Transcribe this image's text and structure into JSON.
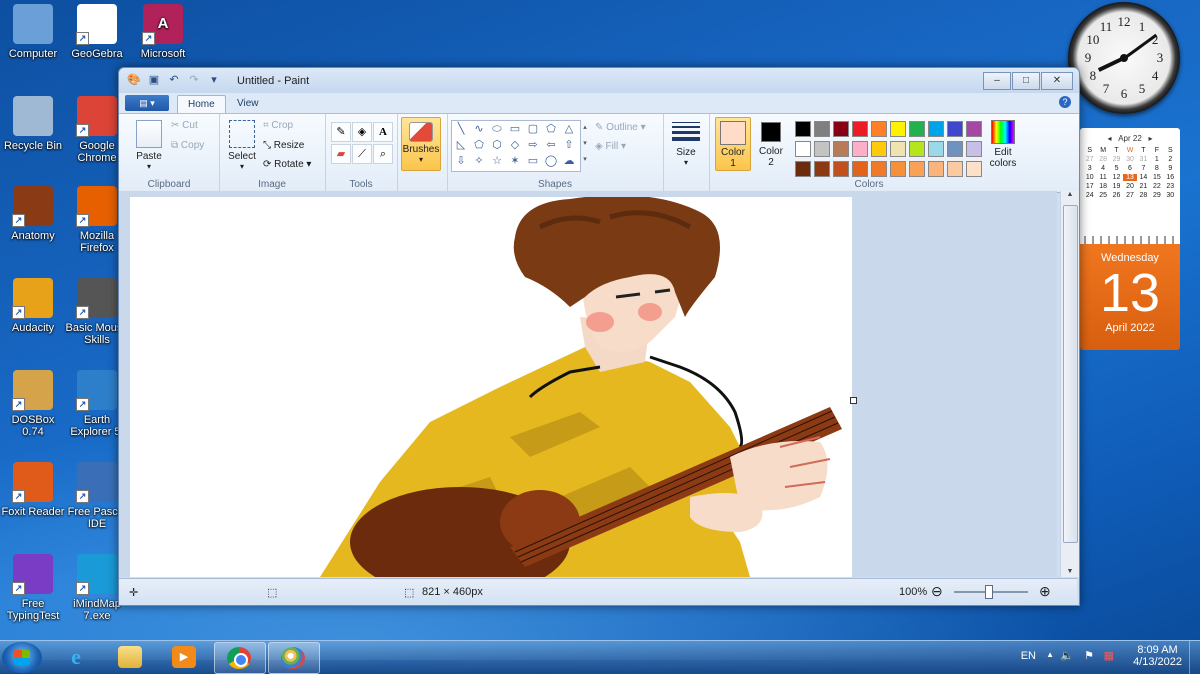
{
  "desktop": {
    "icons_left": [
      {
        "label": "Computer",
        "icon": "computer-icon",
        "color": "#6a9fd8"
      },
      {
        "label": "Recycle Bin",
        "icon": "recycle-bin-icon",
        "color": "#9fb8d4"
      },
      {
        "label": "Anatomy",
        "icon": "anatomy-icon",
        "color": "#8a3b16"
      },
      {
        "label": "Audacity",
        "icon": "audacity-icon",
        "color": "#e8a21a"
      },
      {
        "label": "DOSBox 0.74",
        "icon": "dosbox-icon",
        "color": "#d4a34a"
      },
      {
        "label": "Foxit Reader",
        "icon": "foxit-reader-icon",
        "color": "#e05a1a"
      },
      {
        "label": "Free TypingTest",
        "icon": "free-typingtest-icon",
        "color": "#7a3cc4"
      }
    ],
    "icons_right": [
      {
        "label": "GeoGebra",
        "icon": "geogebra-icon",
        "color": "#ffffff"
      },
      {
        "label": "Google Chrome",
        "icon": "chrome-icon",
        "color": "#db4437"
      },
      {
        "label": "Mozilla Firefox",
        "icon": "firefox-icon",
        "color": "#e66000"
      },
      {
        "label": "Basic Mouse Skills",
        "icon": "basic-mouse-skills-icon",
        "color": "#555555"
      },
      {
        "label": "Earth Explorer 5.",
        "icon": "earth-explorer-icon",
        "color": "#2e7fc9"
      },
      {
        "label": "Free Pascal IDE",
        "icon": "free-pascal-icon",
        "color": "#3a6fb8"
      },
      {
        "label": "iMindMap 7.exe",
        "icon": "imindmap-icon",
        "color": "#1a9ad6"
      }
    ],
    "icon_top_partial": {
      "label": "Microsoft",
      "icon": "microsoft-access-icon",
      "color": "#b2225a"
    }
  },
  "clock_gadget": {
    "numbers": [
      "12",
      "1",
      "2",
      "3",
      "4",
      "5",
      "6",
      "7",
      "8",
      "9",
      "10",
      "11"
    ],
    "hour": 8,
    "minute": 9
  },
  "calendar_gadget": {
    "month_header": "Apr 22",
    "weekday_headers": [
      "S",
      "M",
      "T",
      "W",
      "T",
      "F",
      "S"
    ],
    "weeks": [
      [
        "27",
        "28",
        "29",
        "30",
        "31",
        "1",
        "2"
      ],
      [
        "3",
        "4",
        "5",
        "6",
        "7",
        "8",
        "9"
      ],
      [
        "10",
        "11",
        "12",
        "13",
        "14",
        "15",
        "16"
      ],
      [
        "17",
        "18",
        "19",
        "20",
        "21",
        "22",
        "23"
      ],
      [
        "24",
        "25",
        "26",
        "27",
        "28",
        "29",
        "30"
      ]
    ],
    "today": "13",
    "weekday": "Wednesday",
    "day": "13",
    "month_year": "April 2022"
  },
  "paint": {
    "title": "Untitled - Paint",
    "quick_access": [
      "paint-menu-icon",
      "save-icon",
      "undo-icon",
      "redo-icon",
      "customize-icon"
    ],
    "window_buttons": {
      "minimize": "–",
      "maximize": "□",
      "close": "✕"
    },
    "tabs": [
      "Home",
      "View"
    ],
    "active_tab": "Home",
    "help": "?",
    "ribbon": {
      "clipboard": {
        "label": "Clipboard",
        "paste": "Paste",
        "cut": "Cut",
        "copy": "Copy"
      },
      "image": {
        "label": "Image",
        "select": "Select",
        "crop": "Crop",
        "resize": "Resize",
        "rotate": "Rotate"
      },
      "tools": {
        "label": "Tools"
      },
      "brushes": {
        "label": "Brushes"
      },
      "shapes": {
        "label": "Shapes",
        "outline": "Outline",
        "fill": "Fill",
        "glyphs": [
          "╲",
          "∿",
          "⬭",
          "▭",
          "▢",
          "⬠",
          "△",
          "◺",
          "⬠",
          "⬡",
          "◇",
          "⇨",
          "⇦",
          "⇧",
          "⇩",
          "✧",
          "☆",
          "✶",
          "▭",
          "◯",
          "☁"
        ]
      },
      "size": {
        "label": "Size"
      },
      "colors": {
        "label": "Colors",
        "color1": "Color",
        "color1_num": "1",
        "color2": "Color",
        "color2_num": "2",
        "color1_value": "#ffdcc8",
        "color2_value": "#000000",
        "edit_colors": "Edit colors",
        "palette_rows": [
          [
            "#000000",
            "#7f7f7f",
            "#880015",
            "#ed1c24",
            "#ff7f27",
            "#fff200",
            "#22b14c",
            "#00a2e8",
            "#3f48cc",
            "#a349a4"
          ],
          [
            "#ffffff",
            "#c3c3c3",
            "#b97a57",
            "#ffaec9",
            "#ffc90e",
            "#efe4b0",
            "#b5e61d",
            "#99d9ea",
            "#7092be",
            "#c8bfe7"
          ],
          [
            "#6b2b0c",
            "#8b3a14",
            "#c0501c",
            "#e2641c",
            "#f07a2a",
            "#f7903a",
            "#f9a256",
            "#fbb47c",
            "#fccaa0",
            "#fde0c8"
          ]
        ]
      }
    },
    "status": {
      "canvas_size": "821 × 460px",
      "zoom": "100%"
    }
  },
  "taskbar": {
    "apps": [
      "internet-explorer-icon",
      "file-explorer-icon",
      "media-player-icon",
      "chrome-icon",
      "paint-icon"
    ],
    "lang": "EN",
    "time": "8:09 AM",
    "date": "4/13/2022"
  }
}
